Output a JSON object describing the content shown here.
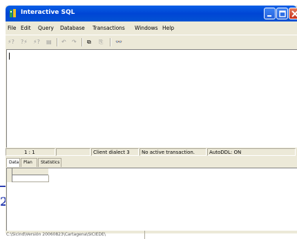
{
  "window": {
    "title": "Interactive SQL",
    "accent": "#0046d5"
  },
  "menu": [
    "File",
    "Edit",
    "Query",
    "Database",
    "Transactions",
    "Windows",
    "Help"
  ],
  "toolbar": {
    "tools": [
      {
        "name": "execute-icon",
        "glyph": "⚡?",
        "enabled": false
      },
      {
        "name": "prepare-icon",
        "glyph": "?⚡",
        "enabled": false
      },
      {
        "name": "plan-icon",
        "glyph": "⚡?",
        "enabled": false
      },
      {
        "name": "list-icon",
        "glyph": "▤",
        "enabled": false
      },
      {
        "name": "undo-icon",
        "glyph": "↶",
        "enabled": false
      },
      {
        "name": "redo-icon",
        "glyph": "↷",
        "enabled": false
      },
      {
        "name": "copy-icon",
        "glyph": "⧉",
        "enabled": true
      },
      {
        "name": "paste-icon",
        "glyph": "⎘",
        "enabled": false
      },
      {
        "name": "binoculars-icon",
        "glyph": "👓",
        "enabled": true
      }
    ]
  },
  "status": {
    "position": "1 :   1",
    "dialect": "Client dialect 3",
    "transaction": "No active transaction.",
    "autoddl": "AutoDDL: ON"
  },
  "tabs": [
    "Data",
    "Plan",
    "Statistics"
  ],
  "path": "C:\\Sicind\\Versión 20060823\\Cartagena\\SICIEDE\\",
  "side_number": "2"
}
